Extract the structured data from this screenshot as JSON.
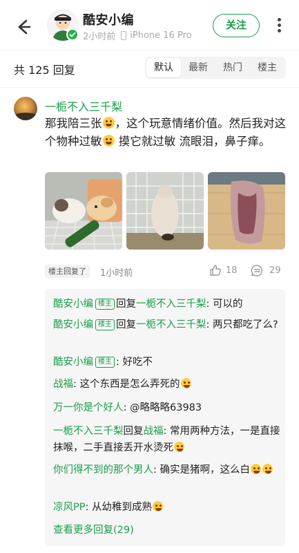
{
  "header": {
    "author_name": "酷安小编",
    "post_time": "2小时前",
    "device": "iPhone 16 Pro",
    "follow_label": "关注"
  },
  "reply_bar": {
    "count_text": "共 125 回复",
    "tabs": [
      "默认",
      "最新",
      "热门",
      "楼主"
    ],
    "active_tab": "默认"
  },
  "comment": {
    "author": "一栀不入三千梨",
    "text_part1": "那我陪三张",
    "text_part2": "，这个玩意情绪价值。然后我对这个物种过敏",
    "text_part3": " 摸它就过敏 流眼泪，鼻子痒。",
    "badge": "楼主回复了",
    "time": "1小时前",
    "likes": "18",
    "replies": "29"
  },
  "subreplies": [
    {
      "user": "酷安小编",
      "is_op": true,
      "op_tag": "楼主",
      "reply_word": "回复",
      "target": "一栀不入三千梨",
      "text": ": 可以的"
    },
    {
      "user": "酷安小编",
      "is_op": true,
      "op_tag": "楼主",
      "reply_word": "回复",
      "target": "一栀不入三千梨",
      "text": ": 两只都吃了么?"
    },
    {
      "user": "酷安小编",
      "is_op": true,
      "op_tag": "楼主",
      "text": ": 好吃不"
    },
    {
      "user": "战福",
      "text": ": 这个东西是怎么弄死的"
    },
    {
      "user": "万一你是个好人",
      "text": ": @略略略63983"
    },
    {
      "user": "一栀不入三千梨",
      "reply_word": "回复",
      "target": "战福",
      "text": ": 常用两种方法，一是直接抹喉，二手直接丢开水烫死"
    },
    {
      "user": "你们得不到的那个男人",
      "text": ": 确实是猪啊，这么白"
    },
    {
      "user": "凉风PP",
      "text": ": 从幼稚到成熟"
    }
  ],
  "more_replies_label": "查看更多回复(29)",
  "colors": {
    "accent_green": "#1a9d4a",
    "subreply_bg": "#f6f6f6",
    "tab_bg": "#f3f3f3"
  },
  "icons": [
    "back-arrow-icon",
    "verified-check-icon",
    "phone-icon",
    "more-vertical-icon",
    "thumb-up-icon",
    "comment-bubble-icon"
  ]
}
